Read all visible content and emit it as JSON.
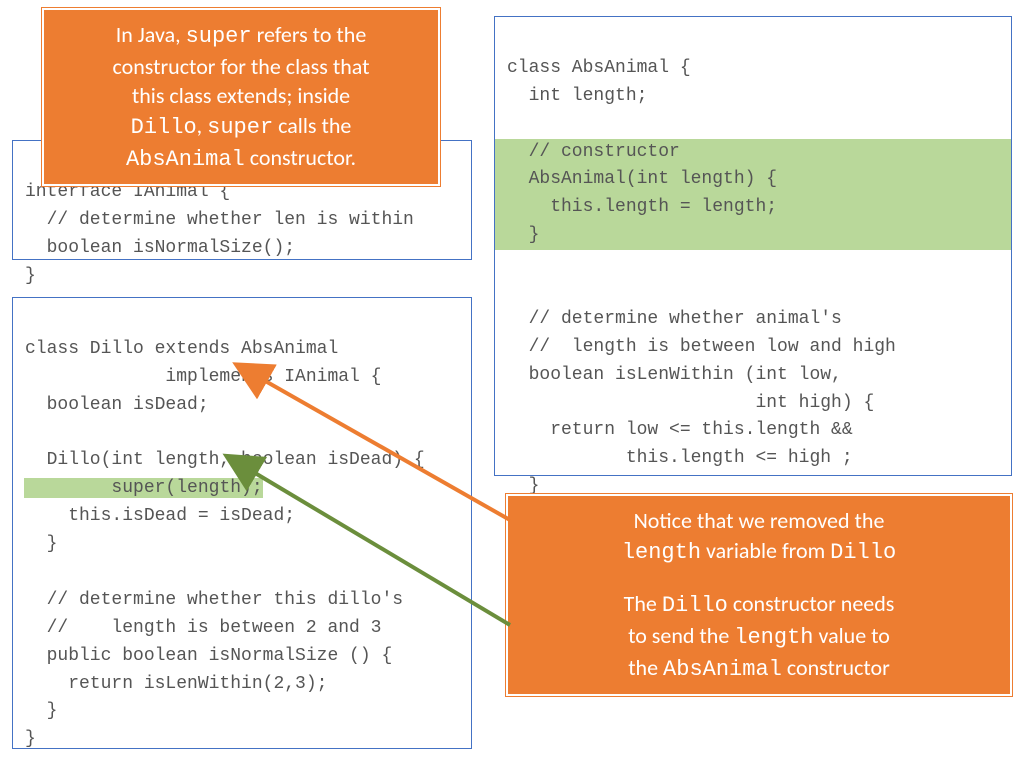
{
  "callout_top": {
    "line1_a": "In Java, ",
    "line1_b": "super",
    "line1_c": " refers to the",
    "line2": "constructor for the class that",
    "line3": "this class extends; inside",
    "line4_a": "Dillo",
    "line4_b": ", ",
    "line4_c": "super",
    "line4_d": " calls the",
    "line5_a": "AbsAnimal",
    "line5_b": " constructor."
  },
  "callout_right": {
    "line1": "Notice that we removed the",
    "line2_a": "length",
    "line2_b": " variable from ",
    "line2_c": "Dillo",
    "line3_a": "The ",
    "line3_b": "Dillo",
    "line3_c": " constructor needs",
    "line4_a": "to send the ",
    "line4_b": "length",
    "line4_c": " value to",
    "line5_a": "the ",
    "line5_b": "AbsAnimal",
    "line5_c": " constructor"
  },
  "code_interface": {
    "l1": "  boolean isNormalSize();",
    "l2": "}"
  },
  "code_dillo": {
    "l1": "class Dillo extends AbsAnimal",
    "l2": "             implements IAnimal {",
    "l3": "  boolean isDead;",
    "l4": "",
    "l5": "  Dillo(int length, boolean isDead) {",
    "l6": "    super(length);",
    "l7": "    this.isDead = isDead;",
    "l8": "  }",
    "l9": "",
    "l10": "  // determine whether this dillo's",
    "l11": "  //    length is between 2 and 3",
    "l12": "  public boolean isNormalSize () {",
    "l13": "    return isLenWithin(2,3);",
    "l14": "  }",
    "l15": "}"
  },
  "code_abs": {
    "l1": "class AbsAnimal {",
    "l2": "  int length;",
    "l3": "",
    "h1": "  // constructor",
    "h2": "  AbsAnimal(int length) {",
    "h3": "    this.length = length;",
    "h4": "  }",
    "l4": "",
    "l5": "  // determine whether animal's",
    "l6": "  //  length is between low and high",
    "l7": "  boolean isLenWithin (int low,",
    "l8": "                       int high) {",
    "l9": "    return low <= this.length &&",
    "l10": "           this.length <= high ;",
    "l11": "  }",
    "l12": "}"
  }
}
